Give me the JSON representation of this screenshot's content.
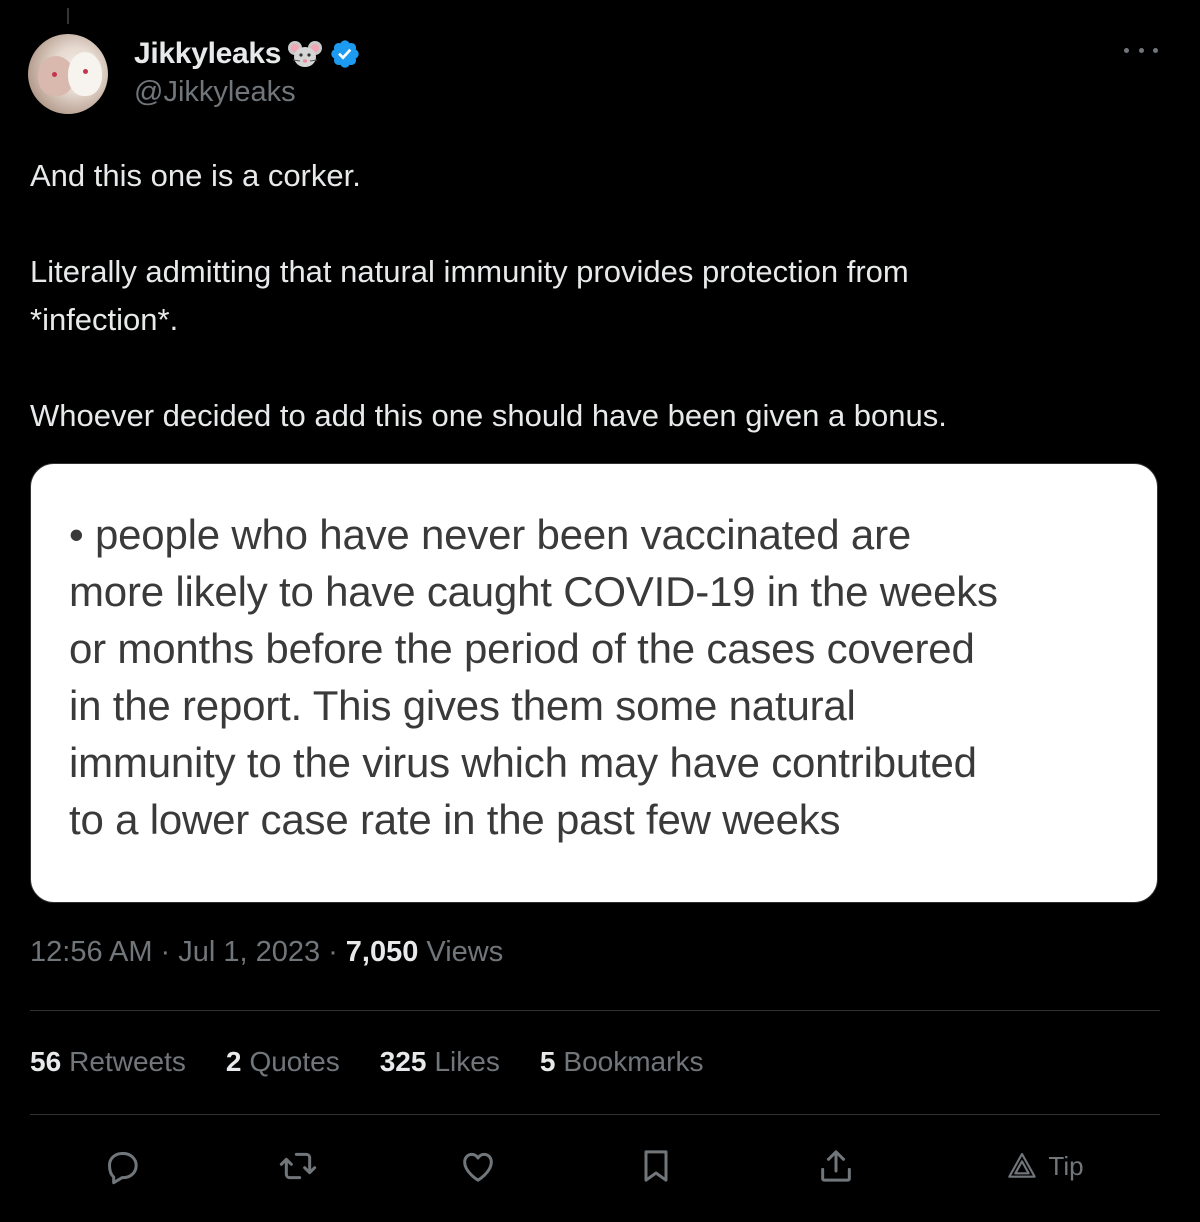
{
  "author": {
    "display_name": "Jikkyleaks",
    "handle": "@Jikkyleaks",
    "avatar_icon": "mice-avatar",
    "badge_emoji": "mouse-face-icon",
    "verified_color": "#1d9bf0"
  },
  "tweet": {
    "paragraphs": [
      "And this one is a corker.",
      "Literally admitting that natural immunity provides protection from\n*infection*.",
      "Whoever decided to add this one should have been given a bonus."
    ]
  },
  "media": {
    "text": "• people who have never been vaccinated are\nmore likely to have caught COVID-19 in the weeks\nor months before the period of the cases covered\nin the report. This gives them some natural\nimmunity to the virus which may have contributed\nto a lower case rate in the past few weeks"
  },
  "meta": {
    "time": "12:56 AM",
    "separator": "·",
    "date": "Jul 1, 2023",
    "views_count": "7,050",
    "views_label": "Views"
  },
  "stats": [
    {
      "count": "56",
      "label": "Retweets"
    },
    {
      "count": "2",
      "label": "Quotes"
    },
    {
      "count": "325",
      "label": "Likes"
    },
    {
      "count": "5",
      "label": "Bookmarks"
    }
  ],
  "actions": {
    "reply_icon": "reply-icon",
    "retweet_icon": "retweet-icon",
    "like_icon": "heart-icon",
    "bookmark_icon": "bookmark-icon",
    "share_icon": "share-icon",
    "tip_label": "Tip"
  },
  "colors": {
    "background": "#000000",
    "text_primary": "#e7e9ea",
    "text_secondary": "#71767b",
    "divider": "#2f3336"
  }
}
